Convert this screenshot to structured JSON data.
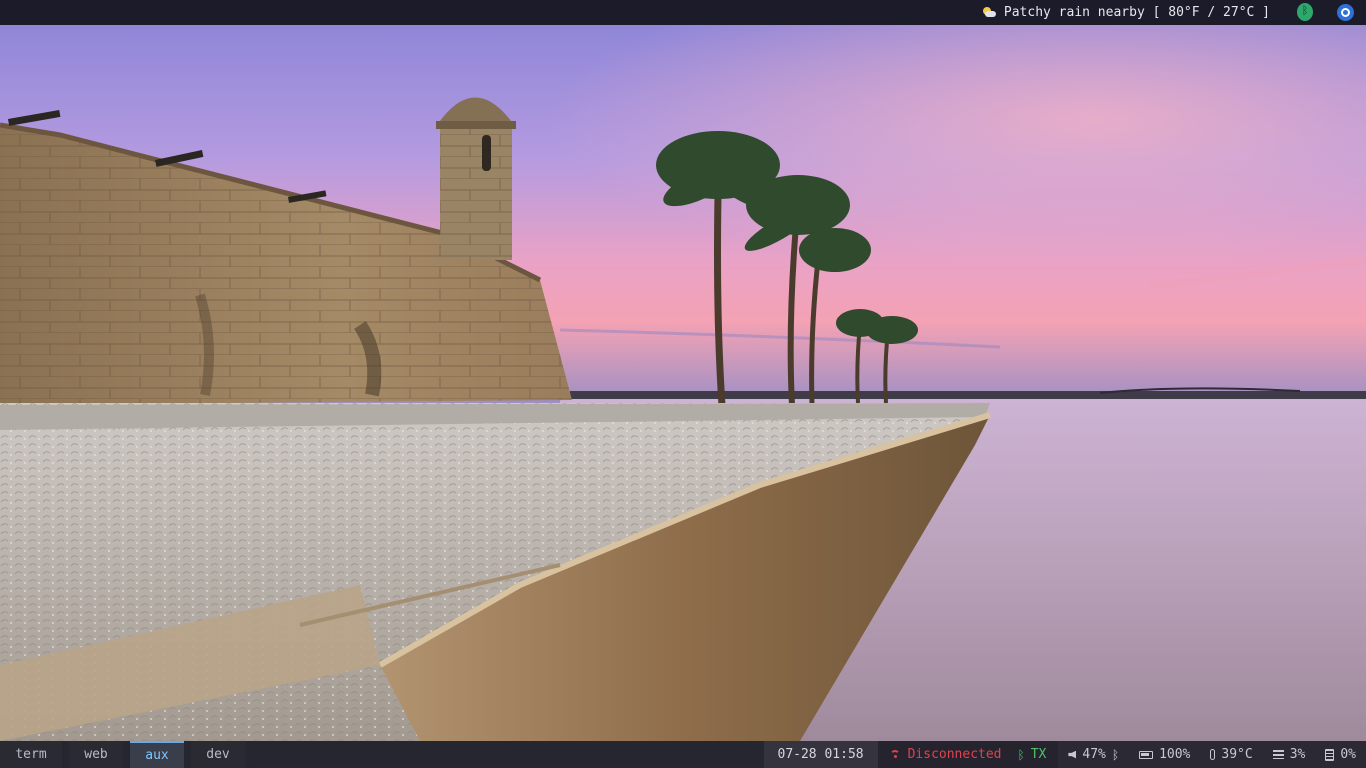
{
  "topbar": {
    "weather_icon": "sun-behind-cloud-icon",
    "weather_text": "Patchy rain nearby [ 80°F / 27°C ]",
    "tray": [
      {
        "name": "bluetooth-tray-icon",
        "color": "#2ea86a"
      },
      {
        "name": "network-tray-icon",
        "color": "#2f6fd6"
      }
    ]
  },
  "workspaces": [
    {
      "label": "term",
      "active": false
    },
    {
      "label": "web",
      "active": false
    },
    {
      "label": "aux",
      "active": true
    },
    {
      "label": "dev",
      "active": false
    }
  ],
  "status": {
    "clock": "07-28 01:58",
    "network": "Disconnected",
    "bluetooth": "TX",
    "volume": "47%",
    "battery": "100%",
    "temperature": "39°C",
    "cpu": "3%",
    "memory": "0%"
  },
  "colors": {
    "bar_bg": "#1c1b29",
    "active_workspace": "#7fc6ff",
    "disconnected": "#e0414e",
    "bluetooth_tx": "#4ec26a"
  }
}
